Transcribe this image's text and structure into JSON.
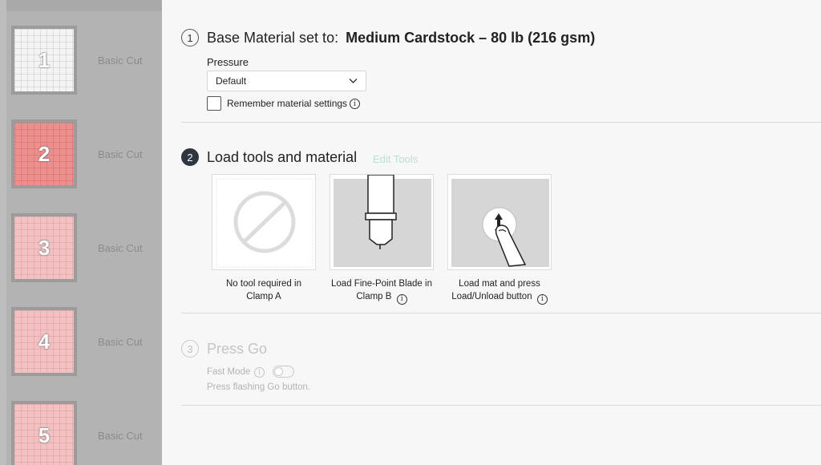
{
  "sidebar": {
    "mats": [
      {
        "number": "1",
        "label": "Basic Cut",
        "color": "white"
      },
      {
        "number": "2",
        "label": "Basic Cut",
        "color": "red",
        "selected": true
      },
      {
        "number": "3",
        "label": "Basic Cut",
        "color": "pink"
      },
      {
        "number": "4",
        "label": "Basic Cut",
        "color": "pink"
      },
      {
        "number": "5",
        "label": "Basic Cut",
        "color": "pink"
      }
    ]
  },
  "step1": {
    "number": "1",
    "title_prefix": "Base Material set to:",
    "material": "Medium Cardstock – 80 lb (216 gsm)",
    "pressure_label": "Pressure",
    "pressure_value": "Default",
    "remember_label": "Remember material settings",
    "remember_checked": false
  },
  "step2": {
    "number": "2",
    "title": "Load tools and material",
    "edit_tools": "Edit Tools",
    "cards": [
      {
        "caption_line1": "No tool required in",
        "caption_line2": "Clamp A",
        "icon": "no-tool-icon"
      },
      {
        "caption_line1": "Load Fine-Point Blade in",
        "caption_line2": "Clamp B",
        "icon": "fine-point-blade-icon",
        "info": true
      },
      {
        "caption_line1": "Load mat and press",
        "caption_line2": "Load/Unload button",
        "icon": "load-unload-press-icon",
        "info": true
      }
    ]
  },
  "step3": {
    "number": "3",
    "title": "Press Go",
    "fast_mode_label": "Fast Mode",
    "fast_mode_on": false,
    "instruction": "Press flashing Go button."
  },
  "colors": {
    "sidebar_bg": "#b3b3b3",
    "main_bg": "#f7f7f7",
    "accent_dark": "#2f3640",
    "edit_tools": "#b9e0d6",
    "mat_selected": "#ec8f8f",
    "mat_pink": "#f2c2c2"
  }
}
